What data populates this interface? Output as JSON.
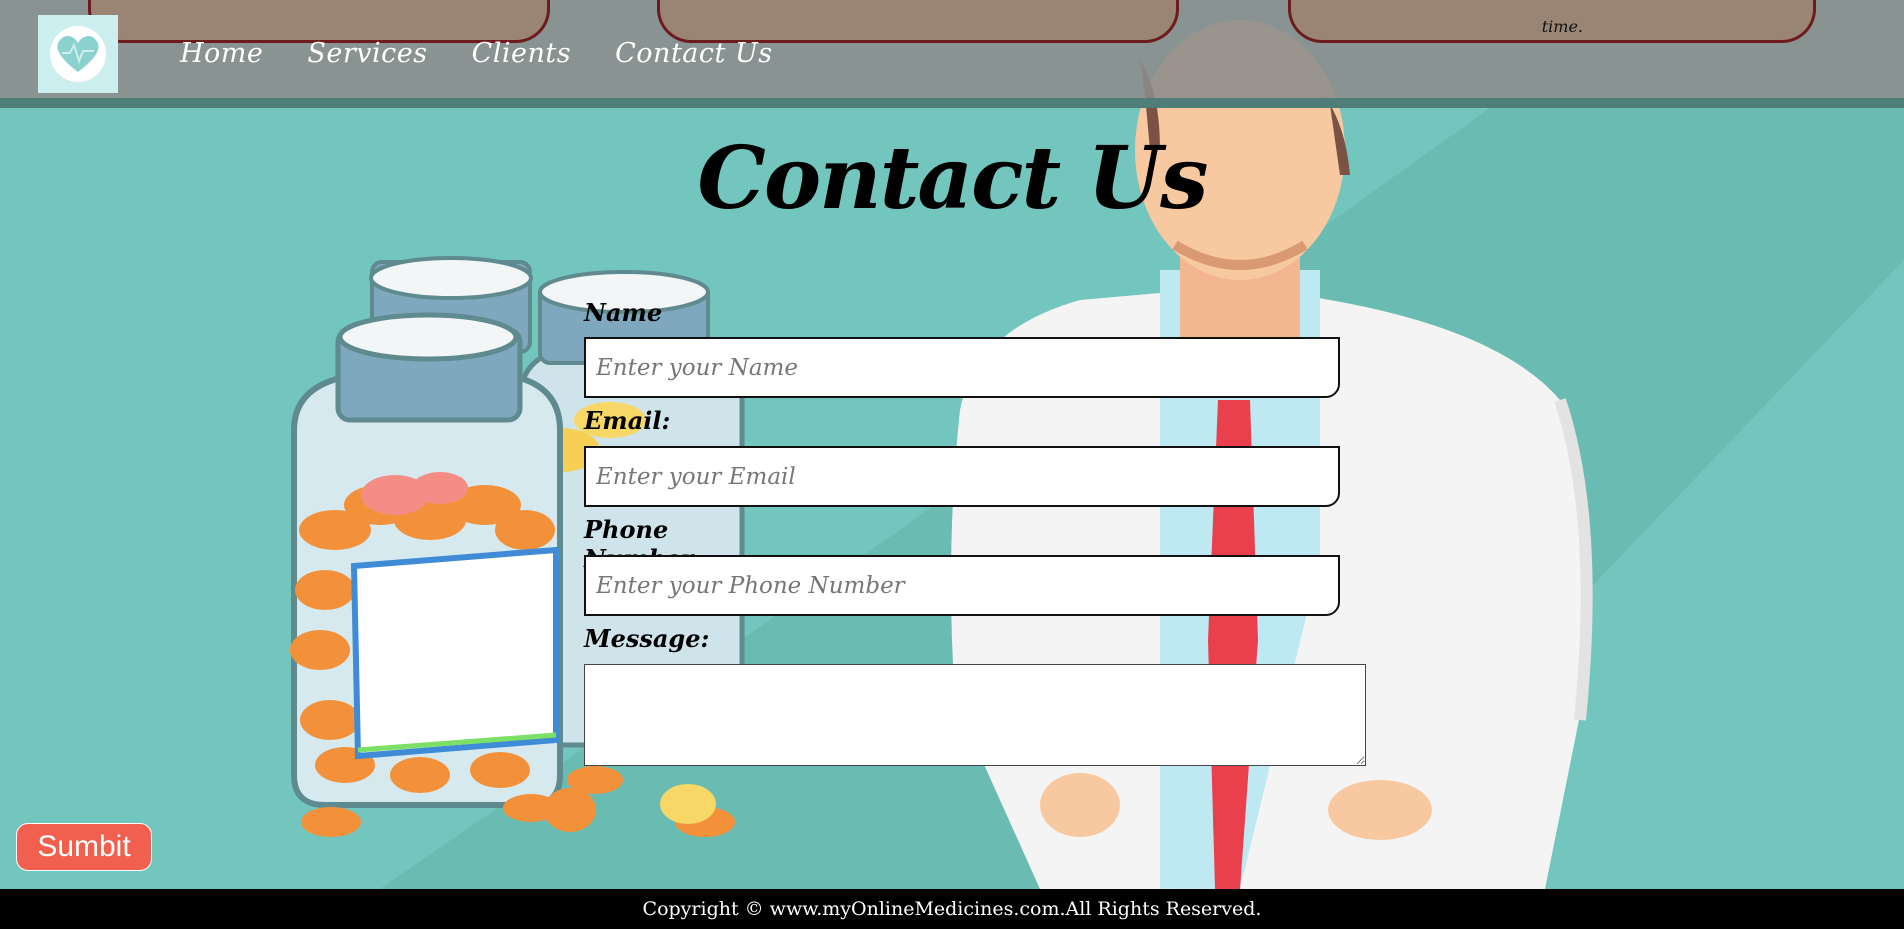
{
  "navbar": {
    "links": [
      "Home",
      "Services",
      "Clients",
      "Contact Us"
    ],
    "card_fragment_text": "time."
  },
  "page": {
    "title": "Contact Us"
  },
  "form": {
    "name_label": "Name :",
    "name_placeholder": "Enter your Name",
    "email_label": "Email:",
    "email_placeholder": "Enter your Email",
    "phone_label": "Phone Number:",
    "phone_placeholder": "Enter your Phone Number",
    "message_label": "Message:",
    "submit_label": "Sumbit"
  },
  "footer": {
    "copyright": "Copyright © www.myOnlineMedicines.com.All Rights Reserved."
  },
  "colors": {
    "background": "#72c6bd",
    "navbar": "#8c8c8c",
    "card": "#9a8574",
    "card_border": "#6d1b1f",
    "submit": "#f1604f",
    "footer": "#000000"
  }
}
